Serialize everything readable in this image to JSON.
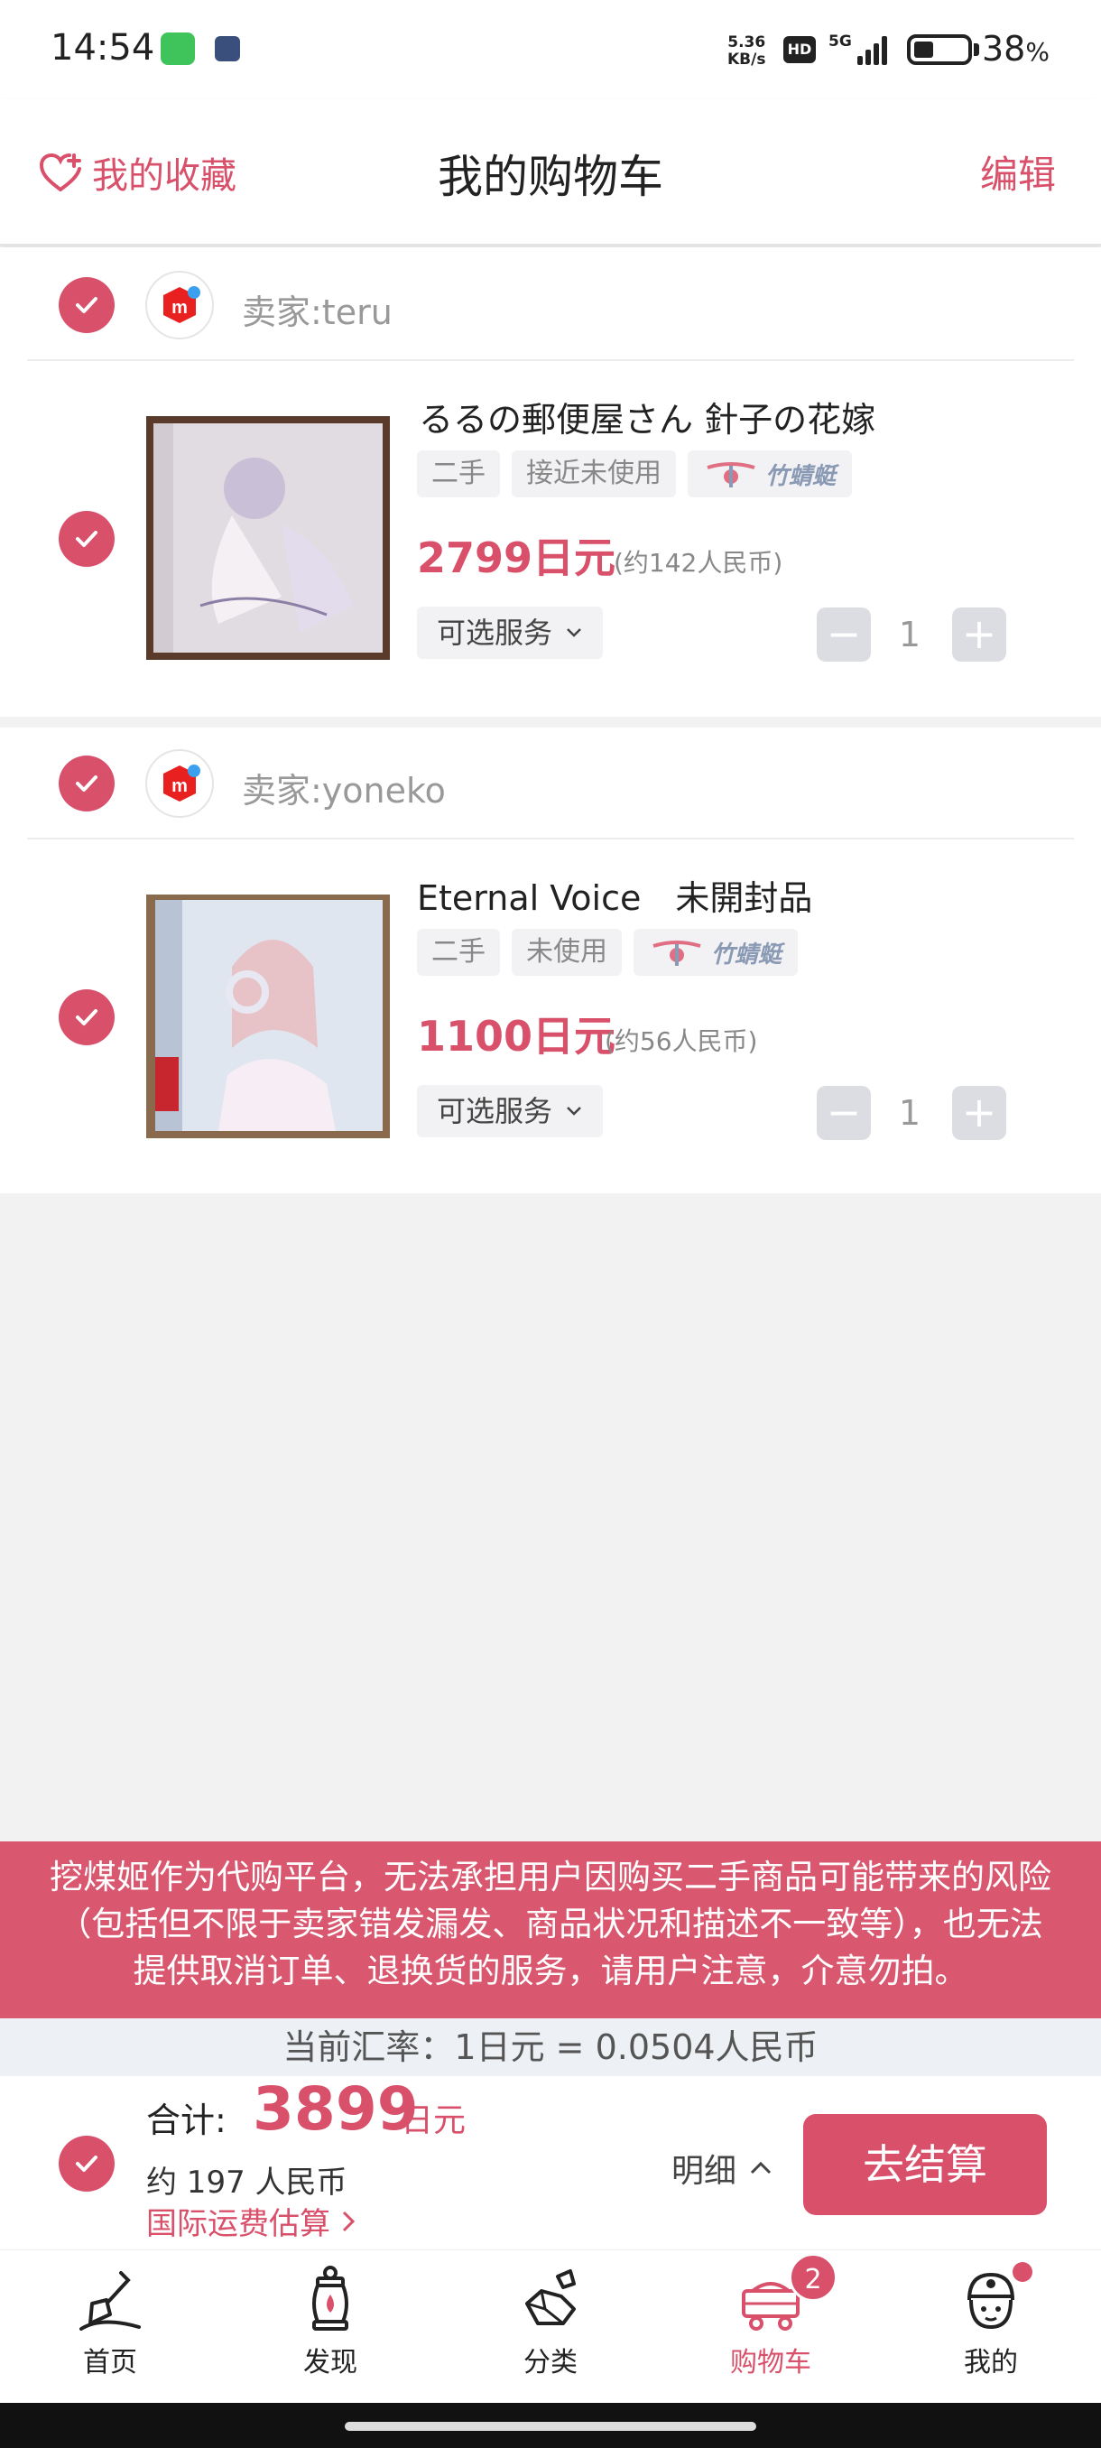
{
  "status_bar": {
    "time": "14:54",
    "net_speed_value": "5.36",
    "net_speed_unit": "KB/s",
    "hd": "HD",
    "network": "5G",
    "battery_percent": "38",
    "battery_suffix": "%",
    "battery_level": 0.38
  },
  "header": {
    "favorites": "我的收藏",
    "title": "我的购物车",
    "edit": "编辑"
  },
  "shops": [
    {
      "seller": "卖家:teru",
      "product": {
        "title": "るるの郵便屋さん 針子の花嫁",
        "tags": [
          "二手",
          "接近未使用"
        ],
        "logo_tag": "竹蜻蜓",
        "price": "2799日元",
        "price_cny": "(约142人民币)",
        "service": "可选服务",
        "quantity": "1"
      }
    },
    {
      "seller": "卖家:yoneko",
      "product": {
        "title": "Eternal Voice　未開封品",
        "tags": [
          "二手",
          "未使用"
        ],
        "logo_tag": "竹蜻蜓",
        "price": "1100日元",
        "price_cny": "(约56人民币)",
        "service": "可选服务",
        "quantity": "1"
      }
    }
  ],
  "disclaimer": {
    "line1": "挖煤姬作为代购平台，无法承担用户因购买二手商品可能带来的风险",
    "line2": "（包括但不限于卖家错发漏发、商品状况和描述不一致等），也无法",
    "line3": "提供取消订单、退换货的服务，请用户注意，介意勿拍。"
  },
  "exchange_rate": "当前汇率：1日元 = 0.0504人民币",
  "footer": {
    "total_label": "合计:",
    "total_value": "3899",
    "total_unit": "日元",
    "total_cny": "约 197 人民币",
    "shipping_estimate": "国际运费估算",
    "detail": "明细",
    "checkout": "去结算"
  },
  "tabbar": {
    "items": [
      {
        "label": "首页",
        "icon": "shovel-icon"
      },
      {
        "label": "发现",
        "icon": "lantern-icon"
      },
      {
        "label": "分类",
        "icon": "coal-icon"
      },
      {
        "label": "购物车",
        "icon": "mine-cart-icon",
        "badge": "2"
      },
      {
        "label": "我的",
        "icon": "miner-avatar-icon"
      }
    ]
  },
  "colors": {
    "accent": "#d9506b",
    "disclaimer_bg": "#d9586f",
    "rate_bg": "#edf0f4",
    "page_bg": "#f2f2f3"
  }
}
